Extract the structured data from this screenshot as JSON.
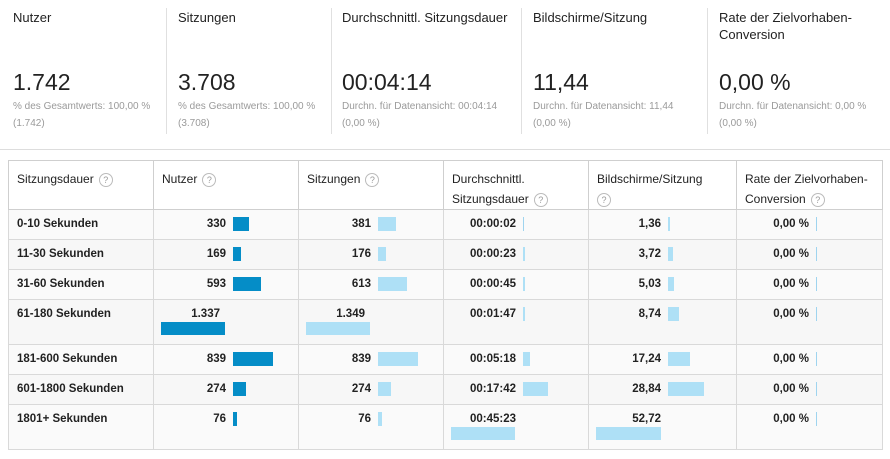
{
  "summary": [
    {
      "label": "Nutzer",
      "value": "1.742",
      "sub1": "% des Gesamtwerts: 100,00 %",
      "sub2": "(1.742)"
    },
    {
      "label": "Sitzungen",
      "value": "3.708",
      "sub1": "% des Gesamtwerts: 100,00 %",
      "sub2": "(3.708)"
    },
    {
      "label": "Durchschnittl. Sitzungsdauer",
      "value": "00:04:14",
      "sub1": "Durchn. für Datenansicht: 00:04:14",
      "sub2": "(0,00 %)"
    },
    {
      "label": "Bildschirme/Sitzung",
      "value": "11,44",
      "sub1": "Durchn. für Datenansicht: 11,44",
      "sub2": "(0,00 %)"
    },
    {
      "label": "Rate der Zielvorhaben-",
      "label2": "Conversion",
      "value": "0,00 %",
      "sub1": "Durchn. für Datenansicht: 0,00 %",
      "sub2": "(0,00 %)"
    }
  ],
  "table": {
    "headers": {
      "dim": "Sitzungsdauer",
      "users": "Nutzer",
      "sessions": "Sitzungen",
      "avg1": "Durchschnittl.",
      "avg2": "Sitzungsdauer",
      "pages": "Bildschirme/Sitzung",
      "conv1": "Rate der Zielvorhaben-",
      "conv2": "Conversion",
      "help": "?"
    },
    "rows": [
      {
        "dim": "0-10 Sekunden",
        "users": "330",
        "users_frac": 0.247,
        "sessions": "381",
        "sessions_frac": 0.282,
        "avg": "00:00:02",
        "avg_frac": 0.0,
        "pages": "1,36",
        "pages_frac": 0.026,
        "conv": "0,00 %"
      },
      {
        "dim": "11-30 Sekunden",
        "users": "169",
        "users_frac": 0.126,
        "sessions": "176",
        "sessions_frac": 0.13,
        "avg": "00:00:23",
        "avg_frac": 0.0085,
        "pages": "3,72",
        "pages_frac": 0.071,
        "conv": "0,00 %"
      },
      {
        "dim": "31-60 Sekunden",
        "users": "593",
        "users_frac": 0.444,
        "sessions": "613",
        "sessions_frac": 0.454,
        "avg": "00:00:45",
        "avg_frac": 0.017,
        "pages": "5,03",
        "pages_frac": 0.095,
        "conv": "0,00 %"
      },
      {
        "dim": "61-180 Sekunden",
        "users": "1.337",
        "users_frac": 1.0,
        "sessions": "1.349",
        "sessions_frac": 1.0,
        "avg": "00:01:47",
        "avg_frac": 0.039,
        "pages": "8,74",
        "pages_frac": 0.166,
        "conv": "0,00 %"
      },
      {
        "dim": "181-600 Sekunden",
        "users": "839",
        "users_frac": 0.628,
        "sessions": "839",
        "sessions_frac": 0.622,
        "avg": "00:05:18",
        "avg_frac": 0.117,
        "pages": "17,24",
        "pages_frac": 0.327,
        "conv": "0,00 %"
      },
      {
        "dim": "601-1800 Sekunden",
        "users": "274",
        "users_frac": 0.205,
        "sessions": "274",
        "sessions_frac": 0.203,
        "avg": "00:17:42",
        "avg_frac": 0.391,
        "pages": "28,84",
        "pages_frac": 0.547,
        "conv": "0,00 %"
      },
      {
        "dim": "1801+ Sekunden",
        "users": "76",
        "users_frac": 0.057,
        "sessions": "76",
        "sessions_frac": 0.056,
        "avg": "00:45:23",
        "avg_frac": 1.0,
        "pages": "52,72",
        "pages_frac": 1.0,
        "conv": "0,00 %"
      }
    ]
  },
  "colors": {
    "dark_bar": "#058dc7",
    "light_bar": "#aee0f6"
  }
}
